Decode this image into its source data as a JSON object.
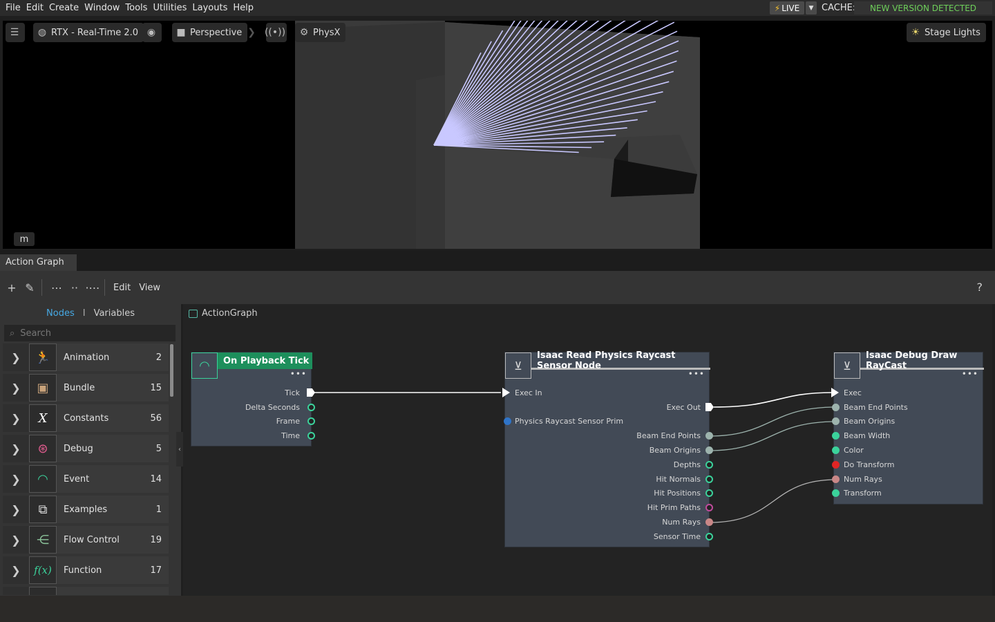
{
  "menu": [
    "File",
    "Edit",
    "Create",
    "Window",
    "Tools",
    "Utilities",
    "Layouts",
    "Help"
  ],
  "live": {
    "label": "LIVE"
  },
  "cache": {
    "label": "CACHE:",
    "status": "NEW VERSION DETECTED"
  },
  "viewport": {
    "renderer": "RTX - Real-Time 2.0",
    "camera": "Perspective",
    "physics": "PhysX",
    "lights": "Stage Lights",
    "mode_key": "m"
  },
  "action_graph": {
    "tab": "Action Graph",
    "toolbar": {
      "edit": "Edit",
      "view": "View",
      "help": "?"
    },
    "library": {
      "tab_nodes": "Nodes",
      "tab_separator": "I",
      "tab_variables": "Variables",
      "search_placeholder": "Search",
      "categories": [
        {
          "name": "Animation",
          "count": "2",
          "icon": "running-figure-icon"
        },
        {
          "name": "Bundle",
          "count": "15",
          "icon": "box-icon"
        },
        {
          "name": "Constants",
          "count": "56",
          "icon": "variable-x-icon"
        },
        {
          "name": "Debug",
          "count": "5",
          "icon": "bug-icon"
        },
        {
          "name": "Event",
          "count": "14",
          "icon": "signal-icon"
        },
        {
          "name": "Examples",
          "count": "1",
          "icon": "examples-icon"
        },
        {
          "name": "Flow Control",
          "count": "19",
          "icon": "flow-icon"
        },
        {
          "name": "Function",
          "count": "17",
          "icon": "function-icon"
        }
      ]
    },
    "canvas": {
      "path": "ActionGraph",
      "nodes": {
        "playback": {
          "title": "On Playback Tick",
          "outputs": [
            "Tick",
            "Delta Seconds",
            "Frame",
            "Time"
          ]
        },
        "raycast": {
          "title": "Isaac Read Physics Raycast Sensor Node",
          "inputs": [
            "Exec In",
            "Physics Raycast Sensor Prim"
          ],
          "outputs": [
            "Exec Out",
            "Beam End Points",
            "Beam Origins",
            "Depths",
            "Hit Normals",
            "Hit Positions",
            "Hit Prim Paths",
            "Num Rays",
            "Sensor Time"
          ]
        },
        "debugdraw": {
          "title": "Isaac Debug Draw RayCast",
          "inputs": [
            "Exec",
            "Beam End Points",
            "Beam Origins",
            "Beam Width",
            "Color",
            "Do Transform",
            "Num Rays",
            "Transform"
          ]
        }
      }
    }
  },
  "colors": {
    "accent_blue": "#46a9e4",
    "cache_green": "#6ed05a",
    "pin_green": "#3bd29b",
    "ray_color": "#c9c8ff"
  }
}
